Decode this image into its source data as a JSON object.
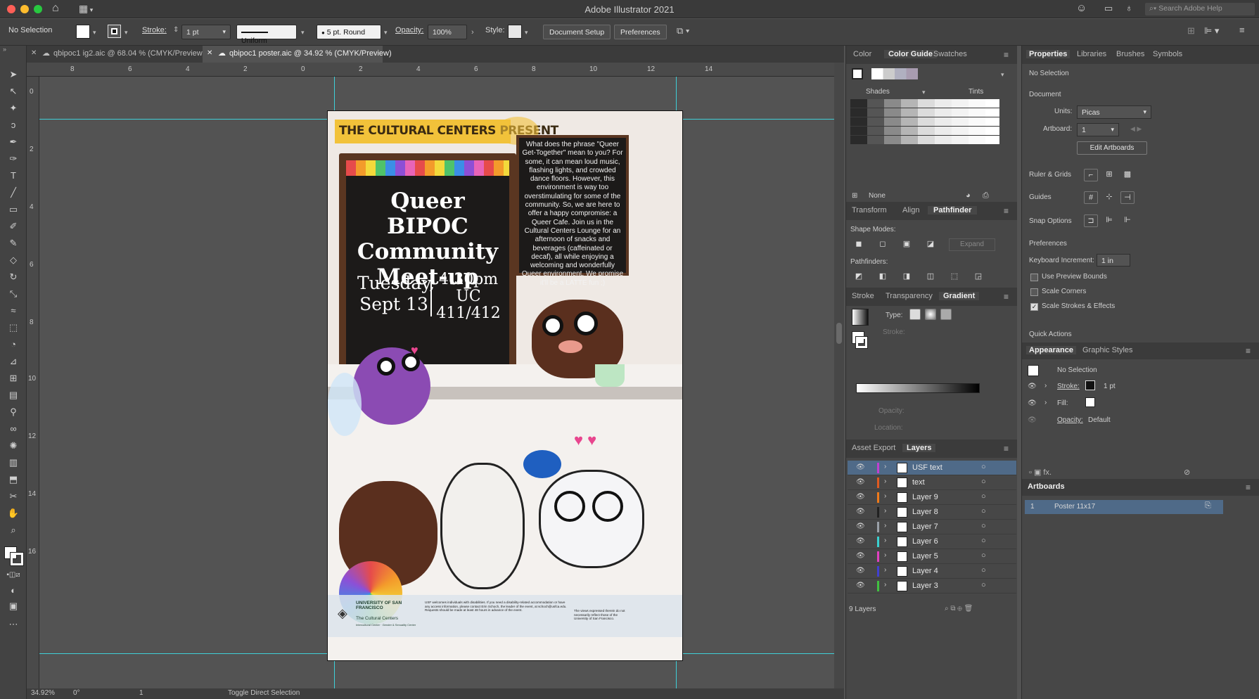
{
  "app": {
    "title": "Adobe Illustrator 2021",
    "search_placeholder": "Search Adobe Help"
  },
  "control": {
    "selection": "No Selection",
    "stroke_label": "Stroke:",
    "stroke_value": "1 pt",
    "profile": "Uniform",
    "brush": "5 pt. Round",
    "opacity_label": "Opacity:",
    "opacity_value": "100%",
    "style_label": "Style:",
    "document_setup": "Document Setup",
    "preferences": "Preferences"
  },
  "tabs": [
    {
      "label": "qbipoc1 ig2.aic @ 68.04 % (CMYK/Preview)"
    },
    {
      "label": "qbipoc1 poster.aic @ 34.92 % (CMYK/Preview)"
    }
  ],
  "ruler": {
    "top": [
      "8",
      "6",
      "4",
      "2",
      "0",
      "2",
      "4",
      "6",
      "8",
      "10",
      "12",
      "14"
    ],
    "left": [
      "0",
      "2",
      "4",
      "6",
      "8",
      "10",
      "12",
      "14",
      "16"
    ]
  },
  "status": {
    "zoom": "34.92%",
    "angle": "0°",
    "artboard": "1",
    "tool": "Toggle Direct Selection"
  },
  "poster": {
    "header": "THE CULTURAL CENTERS PRESENT",
    "title_lines": [
      "Queer BIPOC",
      "Community",
      "Meet-up"
    ],
    "date_lines": [
      "Tuesday,",
      "Sept 13"
    ],
    "time_lines": [
      "4:30pm",
      "UC",
      "411/412"
    ],
    "description": "What does the phrase \"Queer Get-Together\" mean to you? For some, it can mean loud music, flashing lights, and crowded dance floors. However, this environment is way too overstimulating for some of the community. So, we are here to offer a happy compromise: a Queer Cafe. Join us in the Cultural Centers Lounge for an afternoon of snacks and beverages (caffeinated or decaf), all while enjoying a welcoming and wonderfully Queer environment. We promise it'll be a LATTE fun ;)",
    "footer_university": "UNIVERSITY OF SAN FRANCISCO",
    "footer_centers": "The Cultural Centers",
    "footer_sub": "Intercultural Center · Gender & Sexuality Center",
    "footer_accessibility": "USF welcomes individuals with disabilities. If you need a disability-related accommodation or have any access information, please contact Erin Schoch, the leader of the event, at schoch@usfca.edu. Requests should be made at least 48 hours in advance of the event.",
    "footer_views": "The views expressed therein do not necessarily reflect those of the University of San Francisco."
  },
  "color_panel": {
    "tabs": [
      "Color",
      "Color Guide",
      "Swatches"
    ],
    "shades": "Shades",
    "tints": "Tints",
    "none": "None"
  },
  "transform_panel": {
    "tabs": [
      "Transform",
      "Align",
      "Pathfinder"
    ],
    "shape_modes": "Shape Modes:",
    "expand": "Expand",
    "pathfinders": "Pathfinders:"
  },
  "gradient_panel": {
    "tabs": [
      "Stroke",
      "Transparency",
      "Gradient"
    ],
    "type_label": "Type:",
    "stroke_label": "Stroke:",
    "opacity_label": "Opacity:",
    "location_label": "Location:"
  },
  "layers_panel": {
    "tabs": [
      "Asset Export",
      "Layers"
    ],
    "count": "9 Layers",
    "layers": [
      {
        "name": "USF text",
        "color": "#c040d0",
        "selected": true
      },
      {
        "name": "text",
        "color": "#e05a20"
      },
      {
        "name": "Layer 9",
        "color": "#ef7a1a"
      },
      {
        "name": "Layer 8",
        "color": "#222222"
      },
      {
        "name": "Layer 7",
        "color": "#9aa0a8"
      },
      {
        "name": "Layer 6",
        "color": "#3ad0d0"
      },
      {
        "name": "Layer 5",
        "color": "#e040c0"
      },
      {
        "name": "Layer 4",
        "color": "#4040d0"
      },
      {
        "name": "Layer 3",
        "color": "#40c040"
      }
    ]
  },
  "properties": {
    "tabs": [
      "Properties",
      "Libraries",
      "Brushes",
      "Symbols"
    ],
    "selection": "No Selection",
    "document": "Document",
    "units_label": "Units:",
    "units_value": "Picas",
    "artboard_label": "Artboard:",
    "artboard_value": "1",
    "edit_artboards": "Edit Artboards",
    "rulers_grids": "Ruler & Grids",
    "guides": "Guides",
    "snap_options": "Snap Options",
    "preferences": "Preferences",
    "keyboard_increment_label": "Keyboard Increment:",
    "keyboard_increment_value": "1 in",
    "use_preview_bounds": "Use Preview Bounds",
    "scale_corners": "Scale Corners",
    "scale_strokes": "Scale Strokes & Effects",
    "quick_actions": "Quick Actions"
  },
  "appearance": {
    "tabs": [
      "Appearance",
      "Graphic Styles"
    ],
    "selection": "No Selection",
    "stroke_label": "Stroke:",
    "stroke_value": "1 pt",
    "fill_label": "Fill:",
    "opacity_label": "Opacity:",
    "opacity_value": "Default"
  },
  "artboards": {
    "title": "Artboards",
    "items": [
      {
        "num": "1",
        "name": "Poster 11x17"
      }
    ]
  }
}
